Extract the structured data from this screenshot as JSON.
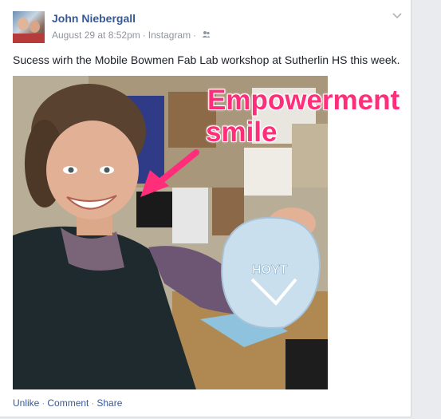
{
  "post": {
    "author": "John Niebergall",
    "date": "August 29 at 8:52pm",
    "separator": "·",
    "source": "Instagram",
    "audience_icon": "friends-icon",
    "menu_icon": "chevron-down-icon",
    "caption": "Sucess wirh the Mobile Bowmen Fab Lab workshop at Sutherlin HS this week.",
    "overlay": {
      "line1": "Empowerment",
      "line2": "smile",
      "color": "#ff2d7a"
    },
    "sticker_text": "HOYT"
  },
  "actions": {
    "unlike": "Unlike",
    "comment": "Comment",
    "share": "Share",
    "dot": "·"
  },
  "colors": {
    "link": "#365899",
    "meta": "#90949c",
    "text": "#1d2129"
  }
}
